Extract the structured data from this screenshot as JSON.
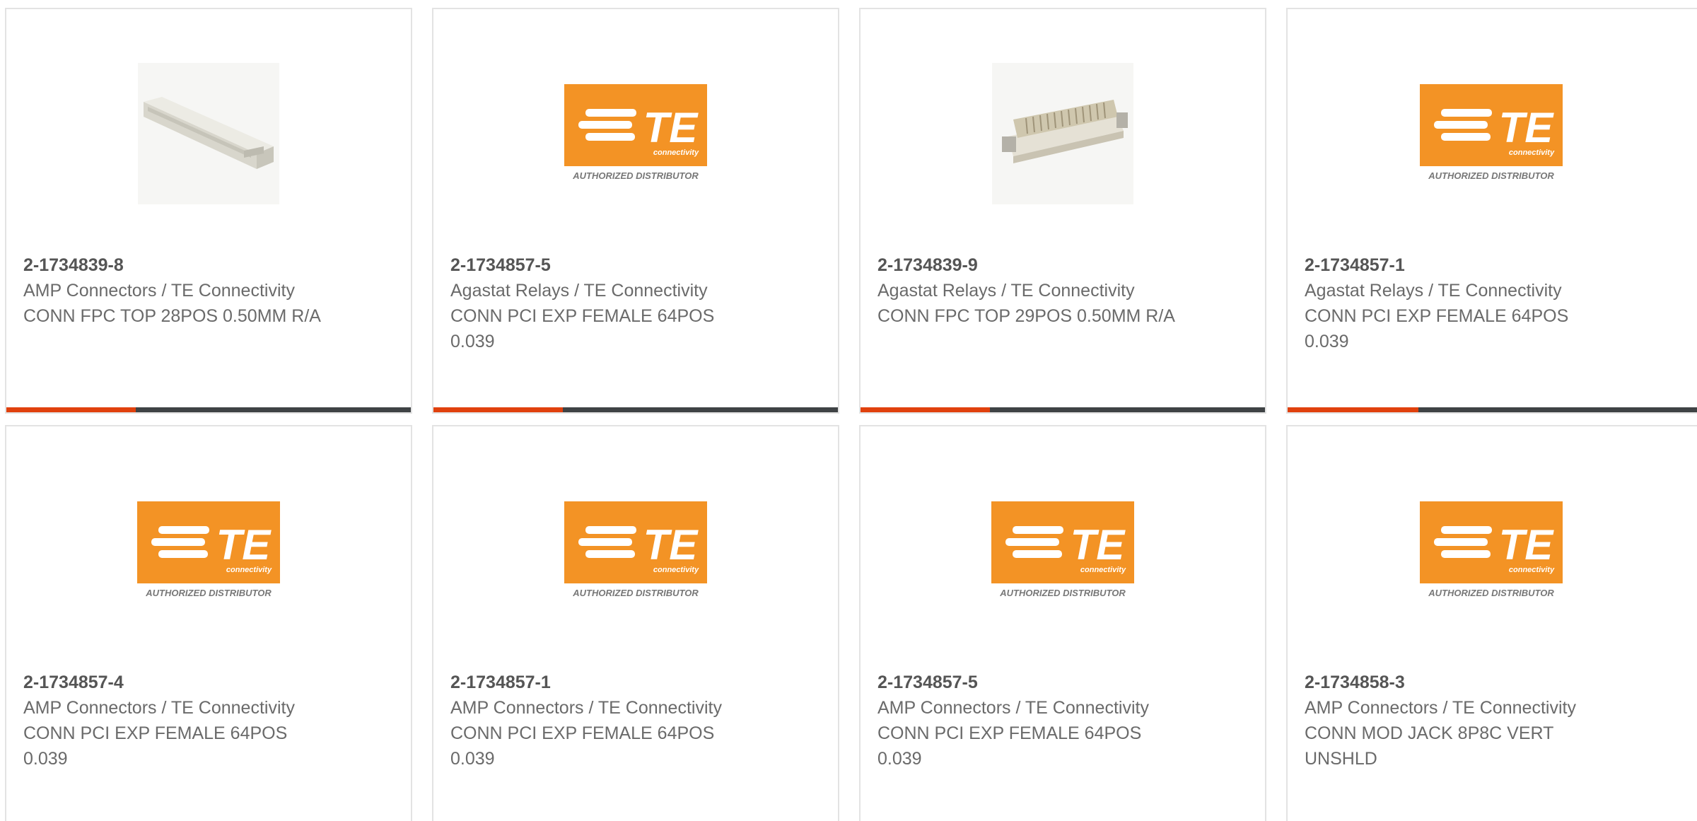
{
  "brand_colors": {
    "te_orange": "#F39325",
    "accent_bar": "#E0410D",
    "bar_dark": "#3F4345"
  },
  "logo": {
    "mark": "TE",
    "sub": "connectivity",
    "tag": "AUTHORIZED DISTRIBUTOR"
  },
  "products": [
    {
      "part_number": "2-1734839-8",
      "manufacturer": "AMP Connectors / TE Connectivity",
      "description": "CONN FPC TOP 28POS 0.50MM R/A",
      "image": "fpc-connector-photo",
      "hover_progress": 0.32
    },
    {
      "part_number": "2-1734857-5",
      "manufacturer": "Agastat Relays / TE Connectivity",
      "description": "CONN PCI EXP FEMALE 64POS 0.039",
      "image": "te-authorized-distributor-logo",
      "hover_progress": 0.32
    },
    {
      "part_number": "2-1734839-9",
      "manufacturer": "Agastat Relays / TE Connectivity",
      "description": "CONN FPC TOP 29POS 0.50MM R/A",
      "image": "fpc-connector-photo",
      "hover_progress": 0.32
    },
    {
      "part_number": "2-1734857-1",
      "manufacturer": "Agastat Relays / TE Connectivity",
      "description": "CONN PCI EXP FEMALE 64POS 0.039",
      "image": "te-authorized-distributor-logo",
      "hover_progress": 0.32
    },
    {
      "part_number": "2-1734857-4",
      "manufacturer": "AMP Connectors / TE Connectivity",
      "description": "CONN PCI EXP FEMALE 64POS 0.039",
      "image": "te-authorized-distributor-logo"
    },
    {
      "part_number": "2-1734857-1",
      "manufacturer": "AMP Connectors / TE Connectivity",
      "description": "CONN PCI EXP FEMALE 64POS 0.039",
      "image": "te-authorized-distributor-logo"
    },
    {
      "part_number": "2-1734857-5",
      "manufacturer": "AMP Connectors / TE Connectivity",
      "description": "CONN PCI EXP FEMALE 64POS 0.039",
      "image": "te-authorized-distributor-logo"
    },
    {
      "part_number": "2-1734858-3",
      "manufacturer": "AMP Connectors / TE Connectivity",
      "description": "CONN MOD JACK 8P8C VERT UNSHLD",
      "image": "te-authorized-distributor-logo"
    }
  ]
}
